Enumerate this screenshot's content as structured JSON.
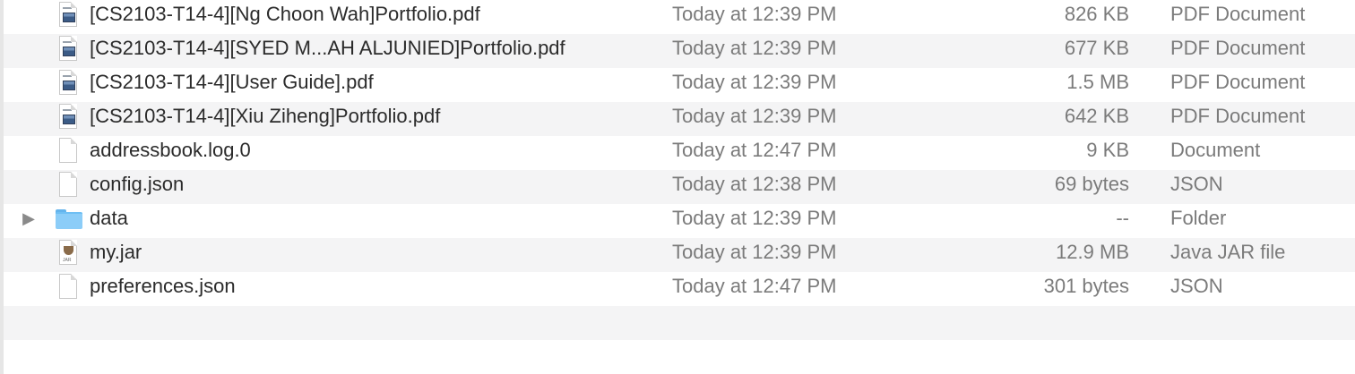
{
  "files": [
    {
      "name": "[CS2103-T14-4][Ng Choon Wah]Portfolio.pdf",
      "date": "Today at 12:39 PM",
      "size": "826 KB",
      "kind": "PDF Document",
      "icon": "pdf-icon",
      "disclosure": ""
    },
    {
      "name": "[CS2103-T14-4][SYED M...AH ALJUNIED]Portfolio.pdf",
      "date": "Today at 12:39 PM",
      "size": "677 KB",
      "kind": "PDF Document",
      "icon": "pdf-icon",
      "disclosure": ""
    },
    {
      "name": "[CS2103-T14-4][User Guide].pdf",
      "date": "Today at 12:39 PM",
      "size": "1.5 MB",
      "kind": "PDF Document",
      "icon": "pdf-icon",
      "disclosure": ""
    },
    {
      "name": "[CS2103-T14-4][Xiu Ziheng]Portfolio.pdf",
      "date": "Today at 12:39 PM",
      "size": "642 KB",
      "kind": "PDF Document",
      "icon": "pdf-icon",
      "disclosure": ""
    },
    {
      "name": "addressbook.log.0",
      "date": "Today at 12:47 PM",
      "size": "9 KB",
      "kind": "Document",
      "icon": "document-icon",
      "disclosure": ""
    },
    {
      "name": "config.json",
      "date": "Today at 12:38 PM",
      "size": "69 bytes",
      "kind": "JSON",
      "icon": "document-icon",
      "disclosure": ""
    },
    {
      "name": "data",
      "date": "Today at 12:39 PM",
      "size": "--",
      "kind": "Folder",
      "icon": "folder-icon",
      "disclosure": "▶"
    },
    {
      "name": "my.jar",
      "date": "Today at 12:39 PM",
      "size": "12.9 MB",
      "kind": "Java JAR file",
      "icon": "jar-icon",
      "disclosure": ""
    },
    {
      "name": "preferences.json",
      "date": "Today at 12:47 PM",
      "size": "301 bytes",
      "kind": "JSON",
      "icon": "document-icon",
      "disclosure": ""
    }
  ],
  "jar_icon_label": "JAR",
  "colors": {
    "alt_row": "#f4f4f5",
    "text": "#2b2b2b",
    "secondary_text": "#7b7b7b",
    "folder": "#8ccdf8"
  }
}
